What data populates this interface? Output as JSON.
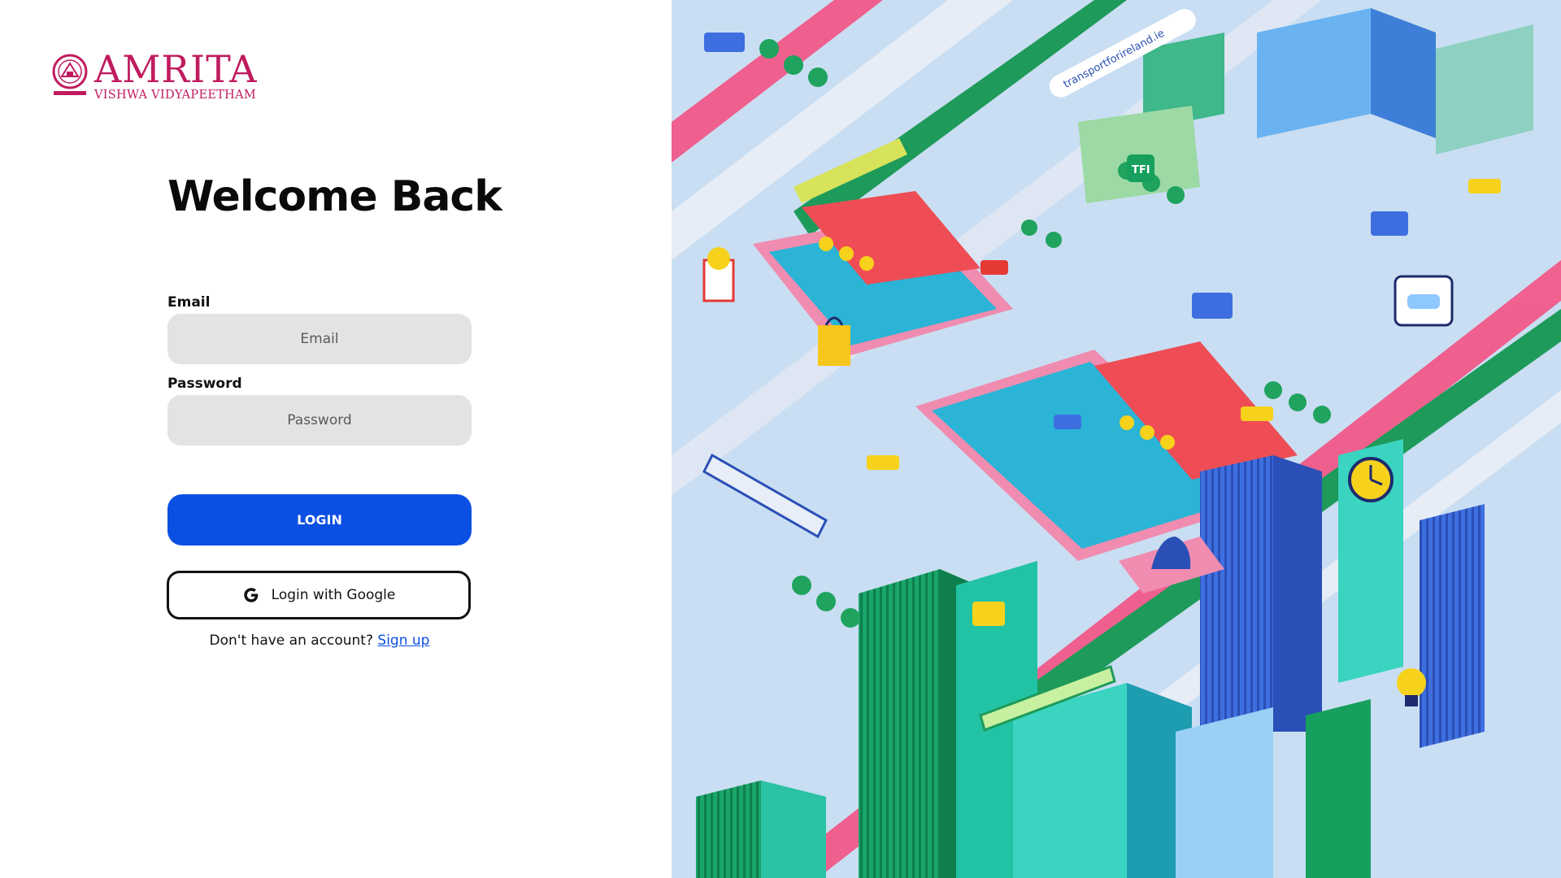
{
  "brand": {
    "name": "AMRITA",
    "subtitle": "VISHWA VIDYAPEETHAM",
    "color": "#c01b5f"
  },
  "login": {
    "title": "Welcome Back",
    "email_label": "Email",
    "email_placeholder": "Email",
    "email_value": "",
    "password_label": "Password",
    "password_placeholder": "Password",
    "password_value": "",
    "login_button": "LOGIN",
    "google_button": "Login with Google",
    "google_icon": "google-icon",
    "signup_prompt": "Don't have an account?",
    "signup_link": "Sign up",
    "accent_color": "#0c4fe3"
  },
  "illustration": {
    "website_text": "transportforireland.ie",
    "badge_text": "TFI"
  }
}
